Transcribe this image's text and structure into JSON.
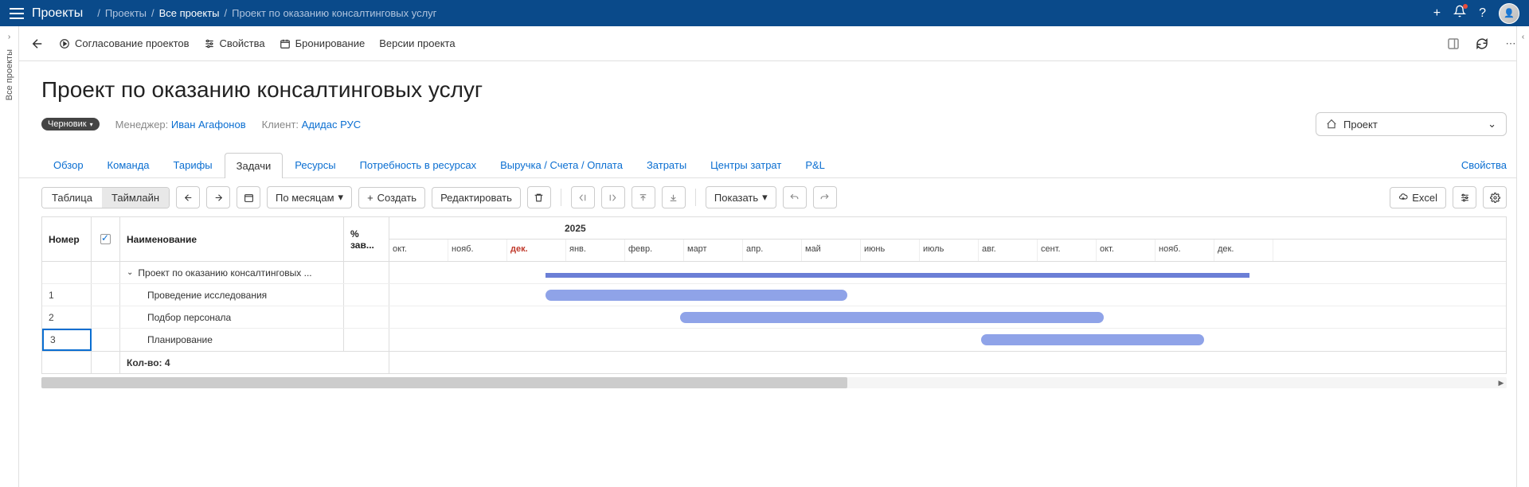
{
  "topbar": {
    "app_title": "Проекты",
    "breadcrumbs": [
      {
        "label": "Проекты",
        "active": false
      },
      {
        "label": "Все проекты",
        "active": true
      },
      {
        "label": "Проект по оказанию консалтинговых услуг",
        "active": false
      }
    ]
  },
  "left_rail": {
    "label": "Все проекты"
  },
  "toolbar": {
    "approval": "Согласование проектов",
    "properties": "Свойства",
    "booking": "Бронирование",
    "versions": "Версии проекта"
  },
  "page": {
    "title": "Проект по оказанию консалтинговых услуг",
    "status": "Черновик",
    "manager_label": "Менеджер:",
    "manager": "Иван Агафонов",
    "client_label": "Клиент:",
    "client": "Адидас РУС",
    "switcher_label": "Проект"
  },
  "tabs": {
    "items": [
      "Обзор",
      "Команда",
      "Тарифы",
      "Задачи",
      "Ресурсы",
      "Потребность в ресурсах",
      "Выручка / Счета / Оплата",
      "Затраты",
      "Центры затрат",
      "P&L"
    ],
    "active_index": 3,
    "right_link": "Свойства"
  },
  "actionbar": {
    "view_table": "Таблица",
    "view_timeline": "Таймлайн",
    "scale_label": "По месяцам",
    "create": "Создать",
    "edit": "Редактировать",
    "show": "Показать",
    "excel": "Excel"
  },
  "gantt": {
    "columns": {
      "number": "Номер",
      "name": "Наименование",
      "pct": "% зав..."
    },
    "year": "2025",
    "months": [
      "окт.",
      "нояб.",
      "дек.",
      "янв.",
      "февр.",
      "март",
      "апр.",
      "май",
      "июнь",
      "июль",
      "авг.",
      "сент.",
      "окт.",
      "нояб.",
      "дек."
    ],
    "current_month_index": 2,
    "rows": [
      {
        "num": "",
        "name": "Проект по оказанию консалтинговых ...",
        "is_parent": true,
        "bar": {
          "left_pct": 14,
          "width_pct": 63,
          "summary": true
        }
      },
      {
        "num": "1",
        "name": "Проведение исследования",
        "is_parent": false,
        "bar": {
          "left_pct": 14,
          "width_pct": 27
        }
      },
      {
        "num": "2",
        "name": "Подбор персонала",
        "is_parent": false,
        "bar": {
          "left_pct": 26,
          "width_pct": 38
        }
      },
      {
        "num": "3",
        "name": "Планирование",
        "is_parent": false,
        "selected": true,
        "bar": {
          "left_pct": 53,
          "width_pct": 20
        }
      }
    ],
    "footer_count": "Кол-во: 4"
  }
}
